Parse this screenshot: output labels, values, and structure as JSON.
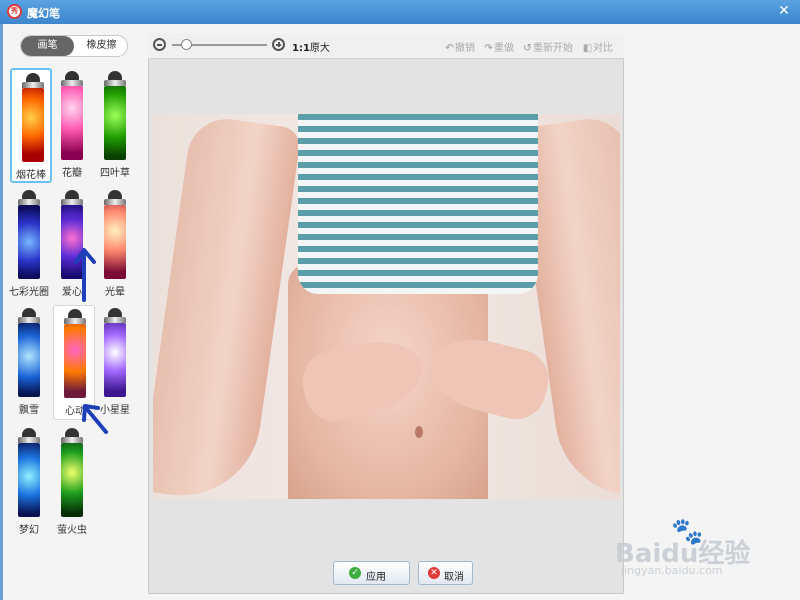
{
  "window": {
    "title": "魔幻笔",
    "logo_text": "秀",
    "close_glyph": "✕"
  },
  "tabs": [
    {
      "label": "画笔",
      "active": true
    },
    {
      "label": "橡皮擦",
      "active": false
    }
  ],
  "pens": [
    {
      "label": "烟花棒",
      "state": "selected"
    },
    {
      "label": "花瓣",
      "state": "normal"
    },
    {
      "label": "四叶草",
      "state": "normal"
    },
    {
      "label": "七彩光圈",
      "state": "normal"
    },
    {
      "label": "爱心",
      "state": "normal"
    },
    {
      "label": "光晕",
      "state": "normal"
    },
    {
      "label": "飘雪",
      "state": "normal"
    },
    {
      "label": "心动",
      "state": "hovered"
    },
    {
      "label": "小星星",
      "state": "normal"
    },
    {
      "label": "梦幻",
      "state": "normal"
    },
    {
      "label": "萤火虫",
      "state": "normal"
    }
  ],
  "toolbar": {
    "ratio_bold": "1:1",
    "ratio_text": "原大",
    "undo": "撤销",
    "redo": "重做",
    "reset": "重新开始",
    "compare": "对比"
  },
  "buttons": {
    "apply": "应用",
    "cancel": "取消"
  },
  "watermark": {
    "brand": "Baidu经验",
    "url": "jingyan.baidu.com"
  },
  "colors": {
    "titlebar": "#3d86cd",
    "selected_border": "#6bc1f2",
    "arrow": "#1f3fb8"
  }
}
